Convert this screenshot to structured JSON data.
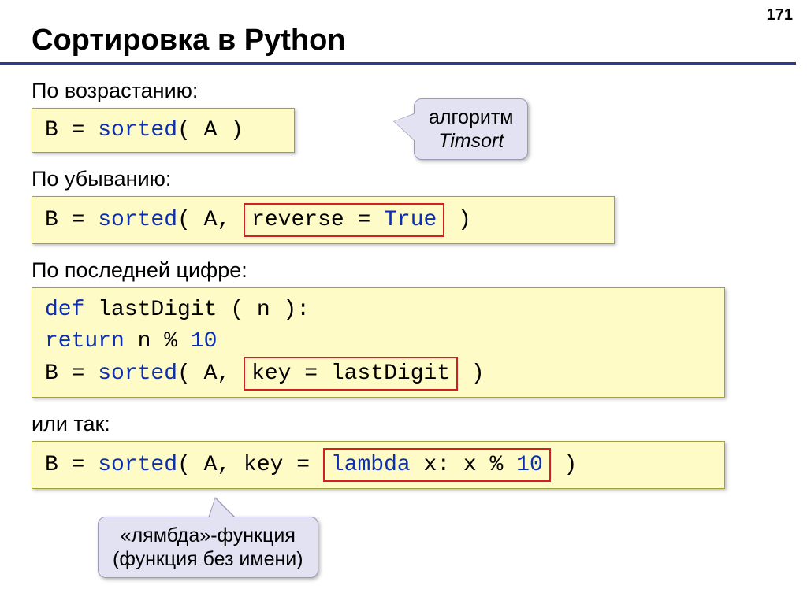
{
  "page_number": "171",
  "title": "Сортировка в Python",
  "labels": {
    "ascending": "По возрастанию:",
    "descending": "По убыванию:",
    "last_digit": "По последней цифре:",
    "or_so": "или так:"
  },
  "code": {
    "line1_pre": "B = ",
    "sorted": "sorted",
    "line1_post": "( A )",
    "line2_pre": "B = ",
    "line2_post1": "( A, ",
    "reverse_box": "reverse = True",
    "line2_post2": " )",
    "def": "def",
    "lastDigit_def": " lastDigit ( n ):",
    "indent": "   ",
    "return": "return",
    "mod_expr_a": " n % ",
    "ten": "10",
    "line3_pre": "B = ",
    "line3_post1": "( A, ",
    "key_box": "key = lastDigit",
    "line3_post2": " )",
    "line4_pre": "B = ",
    "line4_post1": "( A, key = ",
    "lambda": "lambda",
    "lambda_body_a": " x: x % ",
    "line4_post2": " )"
  },
  "tooltip": {
    "timsort_a": "алгоритм",
    "timsort_b": "Timsort",
    "lambda_a": "«лямбда»-функция",
    "lambda_b": "(функция без имени)"
  }
}
